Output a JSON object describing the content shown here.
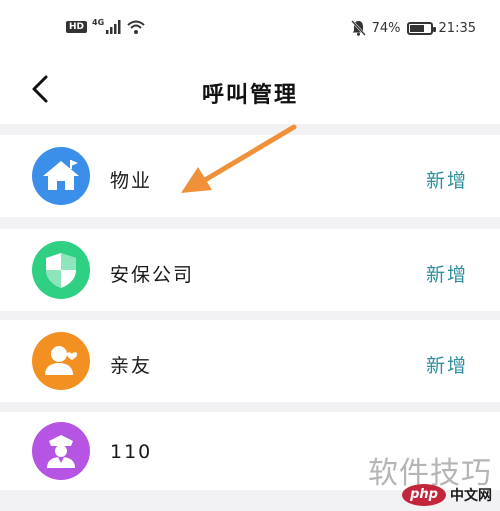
{
  "status_bar": {
    "hd": "HD",
    "signal_label": "4G",
    "battery": "74%",
    "battery_level": 0.74,
    "time": "21:35"
  },
  "header": {
    "title": "呼叫管理"
  },
  "contacts": [
    {
      "label": "物业",
      "action": "新增",
      "icon": "house-icon",
      "color": "#3c8fe8"
    },
    {
      "label": "安保公司",
      "action": "新增",
      "icon": "shield-icon",
      "color": "#2fcf84"
    },
    {
      "label": "亲友",
      "action": "新增",
      "icon": "person-heart-icon",
      "color": "#f29122"
    },
    {
      "label": "110",
      "action": "",
      "icon": "police-icon",
      "color": "#b654e4"
    }
  ],
  "watermark": {
    "text": "软件技巧",
    "brand": "php",
    "brand_suffix": "中文网"
  }
}
